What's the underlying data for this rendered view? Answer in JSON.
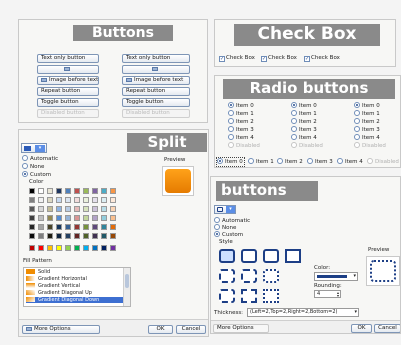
{
  "buttons_panel": {
    "title": "Buttons",
    "text_only_1": "Text only button",
    "text_only_2": "Text only button",
    "image_before_1": "Image before text",
    "image_before_2": "Image before text",
    "repeat_1": "Repeat button",
    "repeat_2": "Repeat button",
    "toggle_1": "Toggle button",
    "toggle_2": "Toggle button",
    "disabled_1": "Disabled button",
    "disabled_2": "Disabled button"
  },
  "checkbox_panel": {
    "title": "Check Box",
    "items": [
      "Check Box",
      "Check Box",
      "Check Box"
    ]
  },
  "radio_panel": {
    "title": "Radio buttons",
    "col1": [
      "Item 0",
      "Item 1",
      "Item 2",
      "Item 3",
      "Item 4",
      "Disabled"
    ],
    "col2": [
      "Item 0",
      "Item 1",
      "Item 2",
      "Item 3",
      "Item 4",
      "Disabled"
    ],
    "col3": [
      "Item 0",
      "Item 1",
      "Item 2",
      "Item 3",
      "Item 4",
      "Disabled"
    ],
    "row": [
      "Item 0",
      "Item 1",
      "Item 2",
      "Item 3",
      "Item 4",
      "Disabled"
    ]
  },
  "split_panel": {
    "title": "Split",
    "automatic": "Automatic",
    "none": "None",
    "custom": "Custom",
    "color_label": "Color",
    "preview_label": "Preview",
    "preview_color": "#f08c00",
    "fill_pattern_label": "Fill Pattern",
    "fill_items": [
      "Solid",
      "Gradient Horizontal",
      "Gradient Vertical",
      "Gradient Diagonal Up",
      "Gradient Diagonal Down"
    ],
    "more_options": "More Options",
    "ok": "OK",
    "cancel": "Cancel",
    "palette": [
      "#000000",
      "#ffffff",
      "#e9e6d6",
      "#1f3760",
      "#4f81bd",
      "#c0504d",
      "#9bbb59",
      "#8064a2",
      "#4bacc6",
      "#f79646",
      "#7f7f7f",
      "#f2f2f2",
      "#ddd9c3",
      "#c6d9f0",
      "#dbe5f1",
      "#f2dcdb",
      "#ebf1dd",
      "#e5e0ec",
      "#dbeef3",
      "#fdeada",
      "#595959",
      "#d8d8d8",
      "#c4bd97",
      "#8db3e2",
      "#b8cce4",
      "#e5b9b7",
      "#d7e3bc",
      "#ccc1d9",
      "#b7dde8",
      "#fbd5b5",
      "#3f3f3f",
      "#bfbfbf",
      "#938953",
      "#548dd4",
      "#95b3d7",
      "#d99694",
      "#c3d69b",
      "#b2a2c7",
      "#92cddc",
      "#fac08f",
      "#262626",
      "#a5a5a5",
      "#494429",
      "#17365d",
      "#366092",
      "#953734",
      "#76923c",
      "#5f497a",
      "#31859b",
      "#e36c09",
      "#0c0c0c",
      "#7f7f7f",
      "#1d1b10",
      "#0f243e",
      "#244061",
      "#632423",
      "#4f6128",
      "#3f3151",
      "#205867",
      "#974806",
      "#c00000",
      "#ff0000",
      "#ffc000",
      "#ffff00",
      "#92d050",
      "#00b050",
      "#00b0f0",
      "#0070c0",
      "#002060",
      "#7030a0"
    ]
  },
  "buttons_dialog": {
    "title": "buttons",
    "automatic": "Automatic",
    "none": "None",
    "custom": "Custom",
    "style_label": "Style",
    "color_label": "Color:",
    "rounding_label": "Rounding:",
    "rounding_value": "4",
    "preview_label": "Preview",
    "thickness_label": "Thickness:",
    "thickness_value": "(Left=2,Top=2,Right=2,Bottom=2)",
    "more_options": "More Options",
    "ok": "OK",
    "cancel": "Cancel"
  }
}
